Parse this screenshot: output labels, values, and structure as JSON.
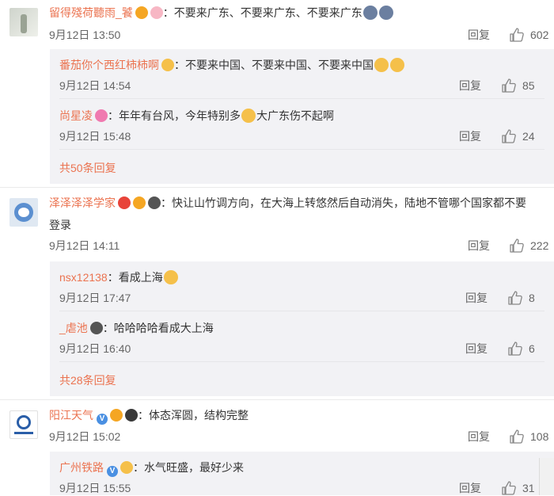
{
  "comments": [
    {
      "username": "留得殘荷聽雨_饕",
      "text": "：不要来广东、不要来广东、不要来广东",
      "time": "9月12日 13:50",
      "reply_label": "回复",
      "likes": "602",
      "replies": [
        {
          "username": "番茄你个西红柿柿啊",
          "text": "：不要来中国、不要来中国、不要来中国",
          "time": "9月12日 14:54",
          "reply_label": "回复",
          "likes": "85"
        },
        {
          "username": "尚星凌",
          "text_a": "：年年有台风，今年特别多",
          "text_b": "大广东伤不起啊",
          "time": "9月12日 15:48",
          "reply_label": "回复",
          "likes": "24"
        }
      ],
      "more_replies": "共50条回复"
    },
    {
      "username": "泽泽泽泽学家",
      "text_line1": "：快让山竹调方向，在大海上转悠然后自动消失，陆地不管哪个国家都不要",
      "text_line2": "登录",
      "time": "9月12日 14:11",
      "reply_label": "回复",
      "likes": "222",
      "replies": [
        {
          "username": "nsx12138",
          "text": "：看成上海",
          "time": "9月12日 17:47",
          "reply_label": "回复",
          "likes": "8"
        },
        {
          "username": "_虐池",
          "text": "：哈哈哈哈看成大上海",
          "time": "9月12日 16:40",
          "reply_label": "回复",
          "likes": "6"
        }
      ],
      "more_replies": "共28条回复"
    },
    {
      "username": "阳江天气",
      "text": "：体态浑圆，结构完整",
      "time": "9月12日 15:02",
      "reply_label": "回复",
      "likes": "108",
      "replies": [
        {
          "username": "广州铁路",
          "text": "：水气旺盛，最好少来",
          "time": "9月12日 15:55",
          "reply_label": "回复",
          "likes": "31"
        }
      ]
    }
  ],
  "colors": {
    "username": "#eb7350",
    "text": "#333333",
    "meta": "#666666",
    "sub_bg": "#f2f2f5"
  },
  "icons": [
    "thumbs-up-icon",
    "vip-badge-icon",
    "emoji-icon",
    "verified-v-icon"
  ]
}
